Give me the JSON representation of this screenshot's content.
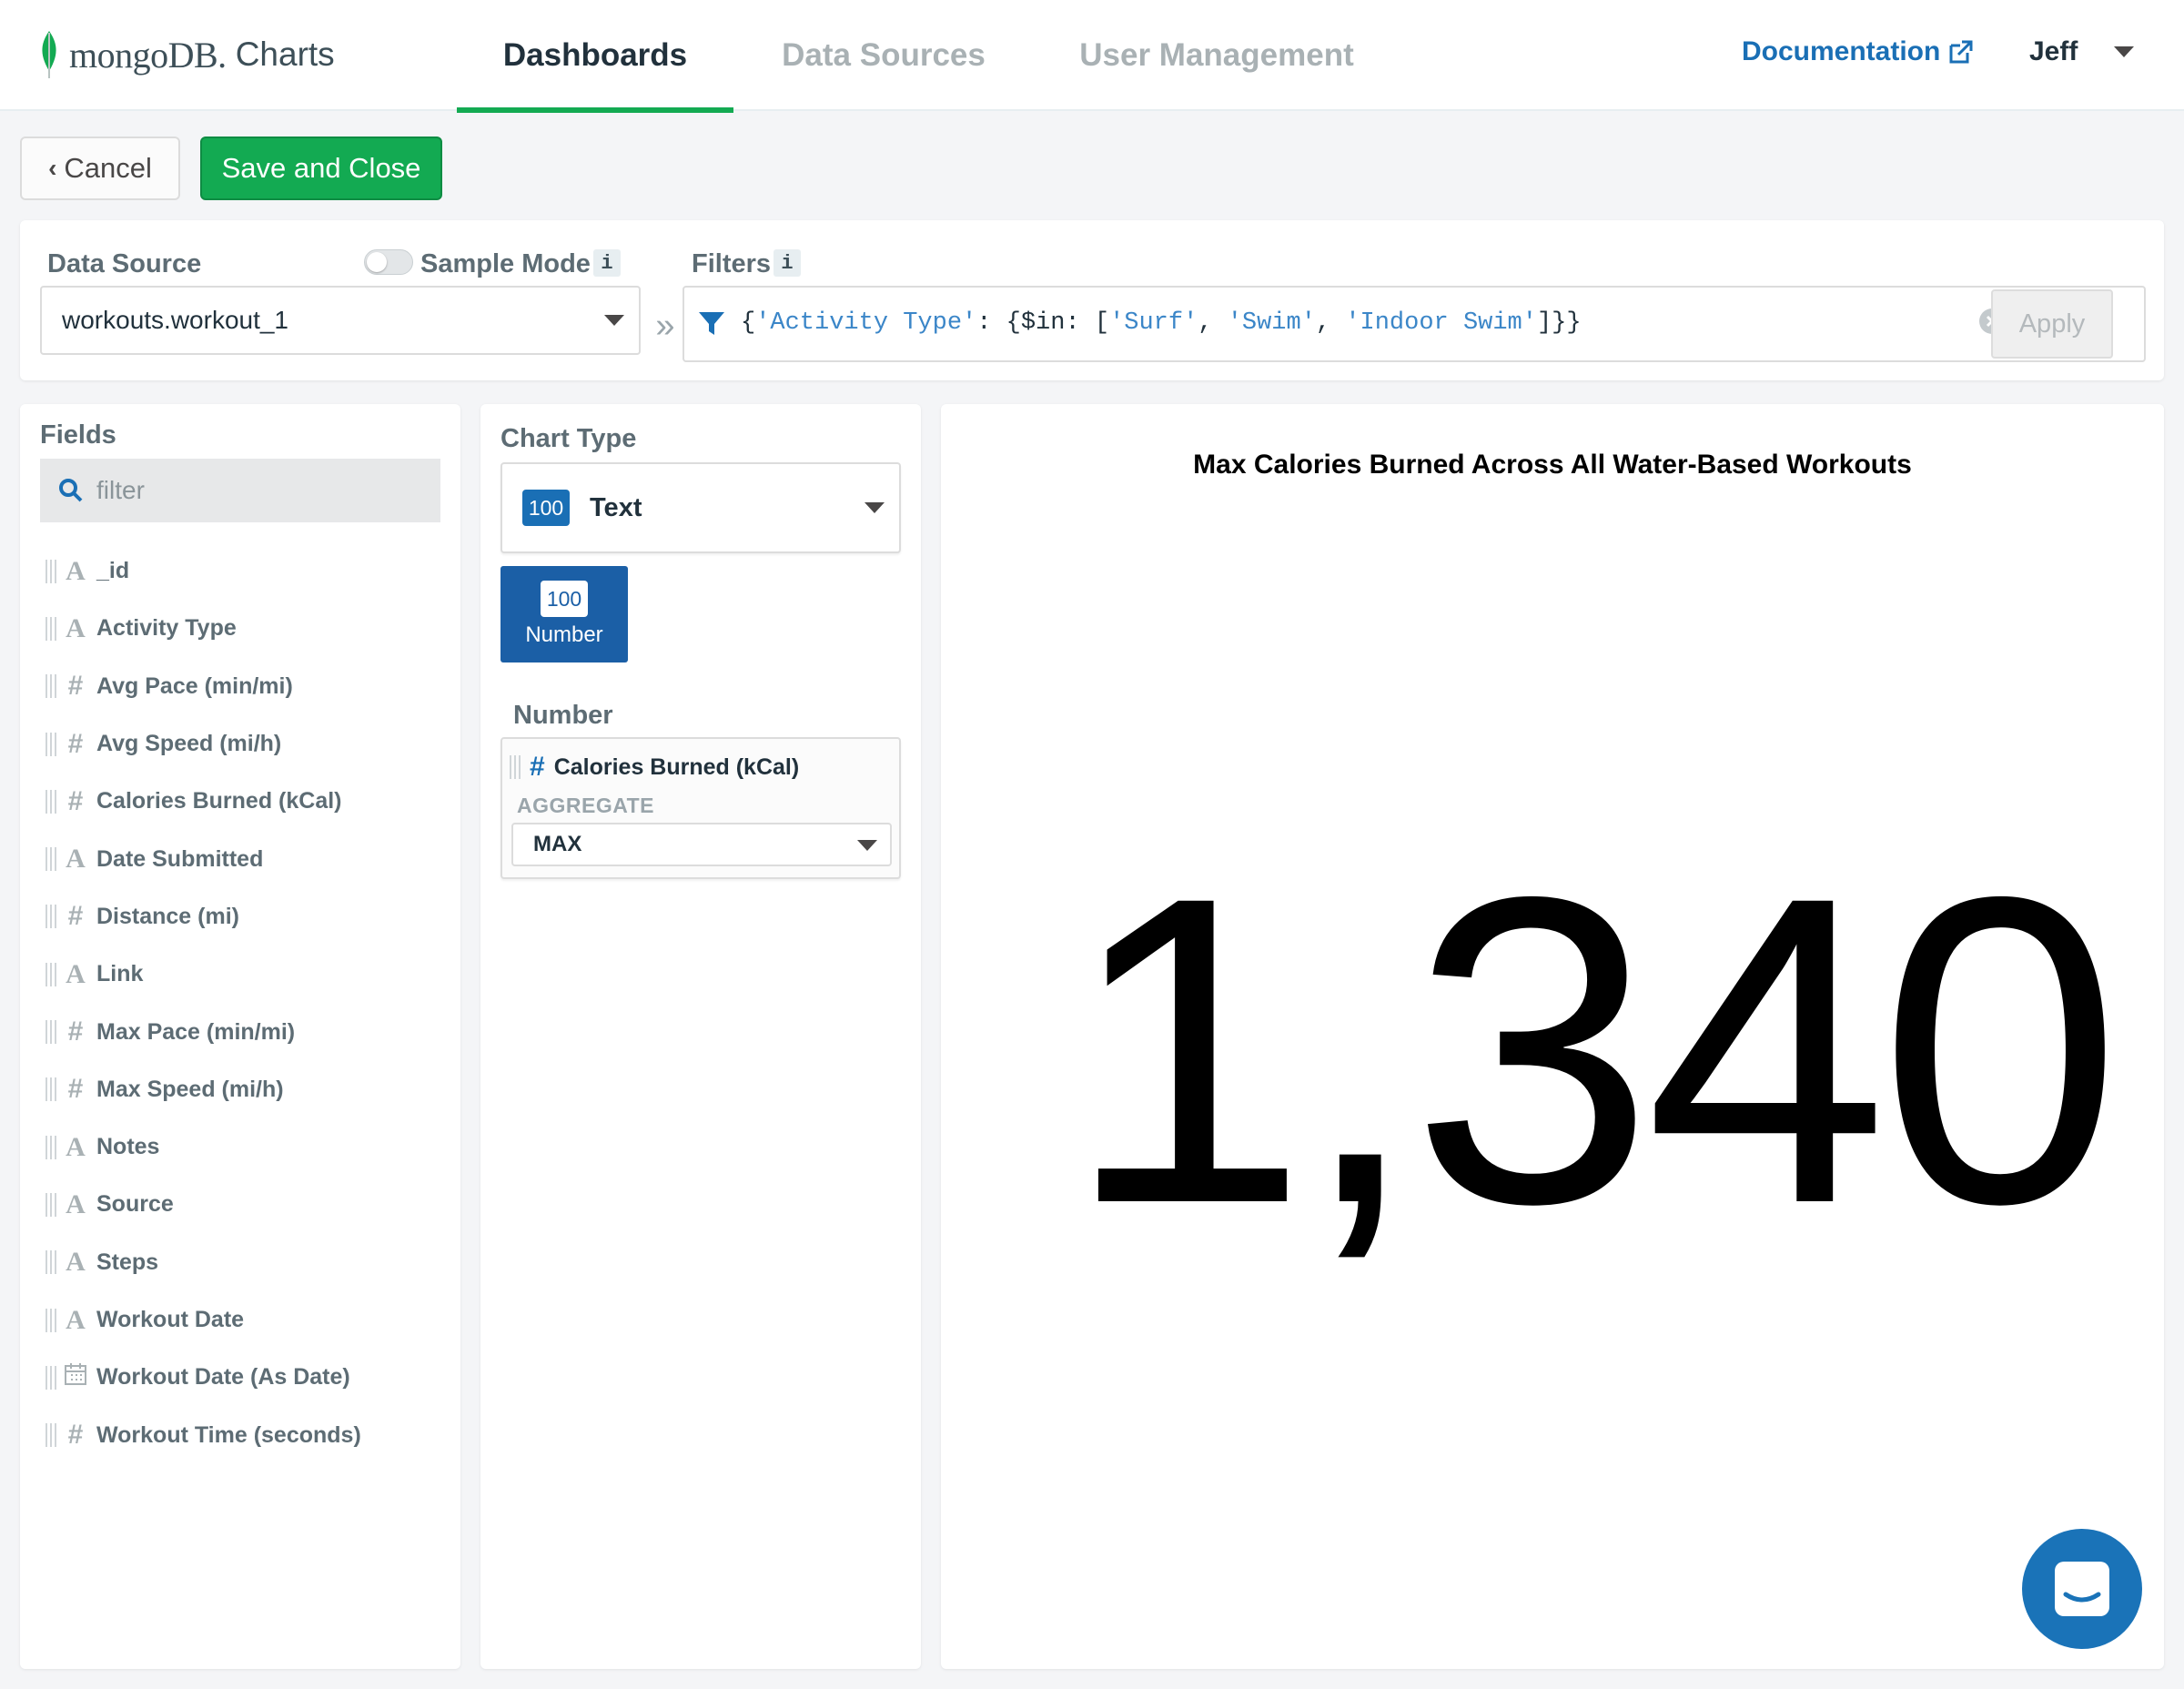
{
  "nav": {
    "logo_text": "mongoDB.",
    "logo_sub": "Charts",
    "tabs": [
      {
        "label": "Dashboards",
        "active": true
      },
      {
        "label": "Data Sources",
        "active": false
      },
      {
        "label": "User Management",
        "active": false
      }
    ],
    "documentation": "Documentation",
    "user": "Jeff"
  },
  "actions": {
    "cancel": "Cancel",
    "save_close": "Save and Close"
  },
  "data_source": {
    "label": "Data Source",
    "sample_mode_label": "Sample Mode",
    "sample_mode_on": false,
    "info": "i",
    "selected": "workouts.workout_1",
    "separator": "»"
  },
  "filters": {
    "label": "Filters",
    "info": "i",
    "query_parts": [
      "{",
      "'Activity Type'",
      ": {$in: [",
      "'Surf'",
      ", ",
      "'Swim'",
      ", ",
      "'Indoor Swim'",
      "]}}"
    ],
    "apply": "Apply"
  },
  "fields": {
    "title": "Fields",
    "search_placeholder": "filter",
    "items": [
      {
        "name": "_id",
        "type": "A"
      },
      {
        "name": "Activity Type",
        "type": "A"
      },
      {
        "name": "Avg Pace (min/mi)",
        "type": "#"
      },
      {
        "name": "Avg Speed (mi/h)",
        "type": "#"
      },
      {
        "name": "Calories Burned (kCal)",
        "type": "#"
      },
      {
        "name": "Date Submitted",
        "type": "A"
      },
      {
        "name": "Distance (mi)",
        "type": "#"
      },
      {
        "name": "Link",
        "type": "A"
      },
      {
        "name": "Max Pace (min/mi)",
        "type": "#"
      },
      {
        "name": "Max Speed (mi/h)",
        "type": "#"
      },
      {
        "name": "Notes",
        "type": "A"
      },
      {
        "name": "Source",
        "type": "A"
      },
      {
        "name": "Steps",
        "type": "A"
      },
      {
        "name": "Workout Date",
        "type": "A"
      },
      {
        "name": "Workout Date (As Date)",
        "type": "date"
      },
      {
        "name": "Workout Time (seconds)",
        "type": "#"
      }
    ]
  },
  "chart_type": {
    "title": "Chart Type",
    "badge": "100",
    "selected": "Text",
    "subtype_badge": "100",
    "subtype_label": "Number",
    "encoding_title": "Number",
    "encoding_field": "Calories Burned (kCal)",
    "aggregate_label": "AGGREGATE",
    "aggregate_value": "MAX"
  },
  "preview": {
    "title": "Max Calories Burned Across All Water-Based Workouts",
    "value": "1,340"
  },
  "colors": {
    "brand_green": "#13aa52",
    "link_blue": "#1a6fb5",
    "chat_blue": "#1a73b8"
  }
}
